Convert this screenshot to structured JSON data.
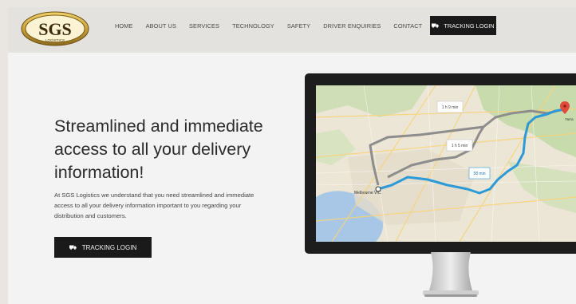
{
  "header": {
    "logo_text": "SGS",
    "logo_sub": "LOGISTICS",
    "nav": [
      "HOME",
      "ABOUT US",
      "SERVICES",
      "TECHNOLOGY",
      "SAFETY",
      "DRIVER ENQUIRIES",
      "CONTACT"
    ],
    "tracking_label": "TRACKING LOGIN"
  },
  "hero": {
    "headline": "Streamlined and immediate access to all your delivery information!",
    "paragraph": "At SGS Logistics we understand that you need streamlined and immediate access to all your delivery information important to you regarding your distribution and customers.",
    "button_label": "TRACKING LOGIN"
  },
  "map": {
    "route_1": "1 h 9 min",
    "route_2": "1 h 5 min",
    "route_3": "58 min",
    "origin": "Melbourne VIC",
    "destination": "Yarra"
  },
  "colors": {
    "brand_gold": "#c9a13b",
    "button_dark": "#1a1a1a",
    "route_blue": "#2d9ad7",
    "route_grey": "#8d8d8d"
  }
}
